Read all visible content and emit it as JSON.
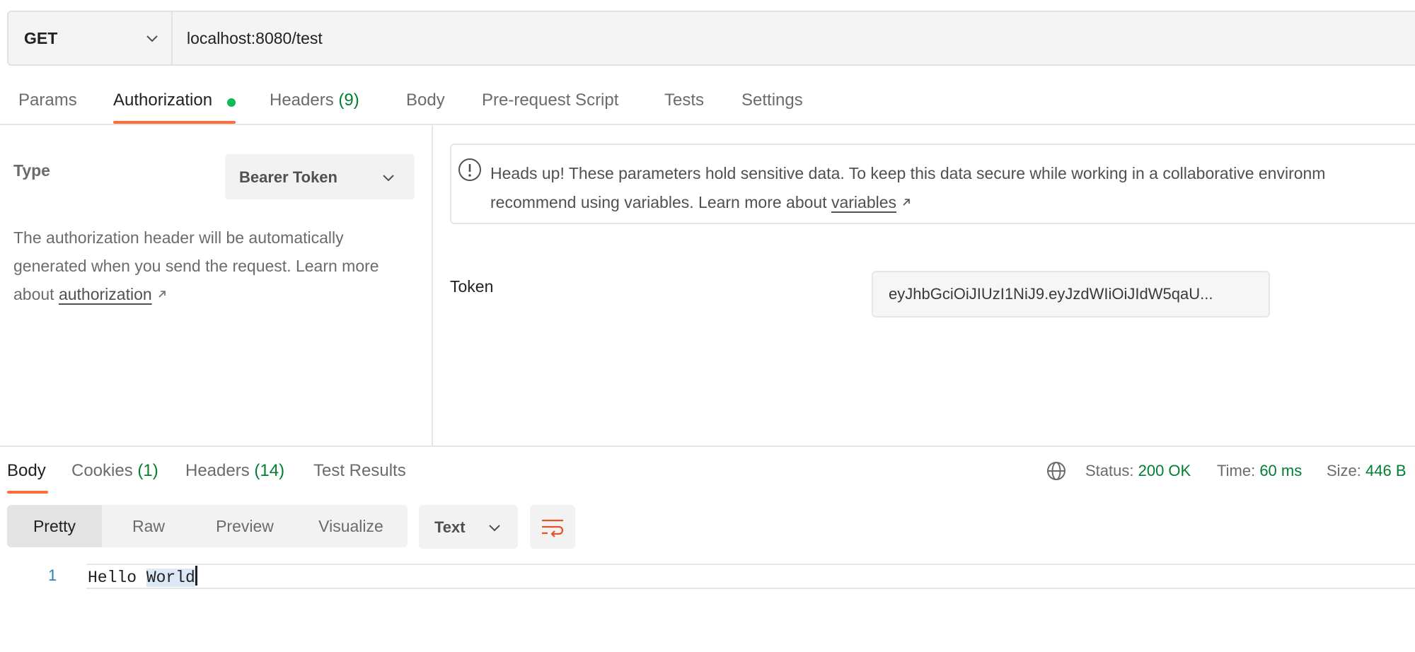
{
  "request": {
    "method": "GET",
    "url": "localhost:8080/test"
  },
  "request_tabs": {
    "params": "Params",
    "authorization": "Authorization",
    "headers": "Headers",
    "headers_count": "(9)",
    "body": "Body",
    "pre_request_script": "Pre-request Script",
    "tests": "Tests",
    "settings": "Settings"
  },
  "auth": {
    "type_label": "Type",
    "type_value": "Bearer Token",
    "description": "The authorization header will be automatically generated when you send the request. Learn more about",
    "description_link": "authorization",
    "notice_line1": "Heads up! These parameters hold sensitive data. To keep this data secure while working in a collaborative environm",
    "notice_line2": "recommend using variables. Learn more about",
    "notice_link": "variables",
    "token_label": "Token",
    "token_value": "eyJhbGciOiJIUzI1NiJ9.eyJzdWIiOiJIdW5qaU..."
  },
  "response_tabs": {
    "body": "Body",
    "cookies": "Cookies",
    "cookies_count": "(1)",
    "headers": "Headers",
    "headers_count": "(14)",
    "test_results": "Test Results"
  },
  "response_stats": {
    "status_label": "Status:",
    "status_value": "200 OK",
    "time_label": "Time:",
    "time_value": "60 ms",
    "size_label": "Size:",
    "size_value": "446 B"
  },
  "response_view": {
    "pretty": "Pretty",
    "raw": "Raw",
    "preview": "Preview",
    "visualize": "Visualize",
    "format": "Text"
  },
  "response_body": {
    "line_number": "1",
    "text_before": "Hello ",
    "text_selected": "World"
  },
  "colors": {
    "accent": "#ff6c37",
    "success": "#007f31",
    "dot": "#0cbb52"
  },
  "icons": {
    "method_chevron": "chevron-down-icon",
    "notice": "info-icon",
    "globe": "globe-icon",
    "wrap": "wrap-lines-icon"
  }
}
